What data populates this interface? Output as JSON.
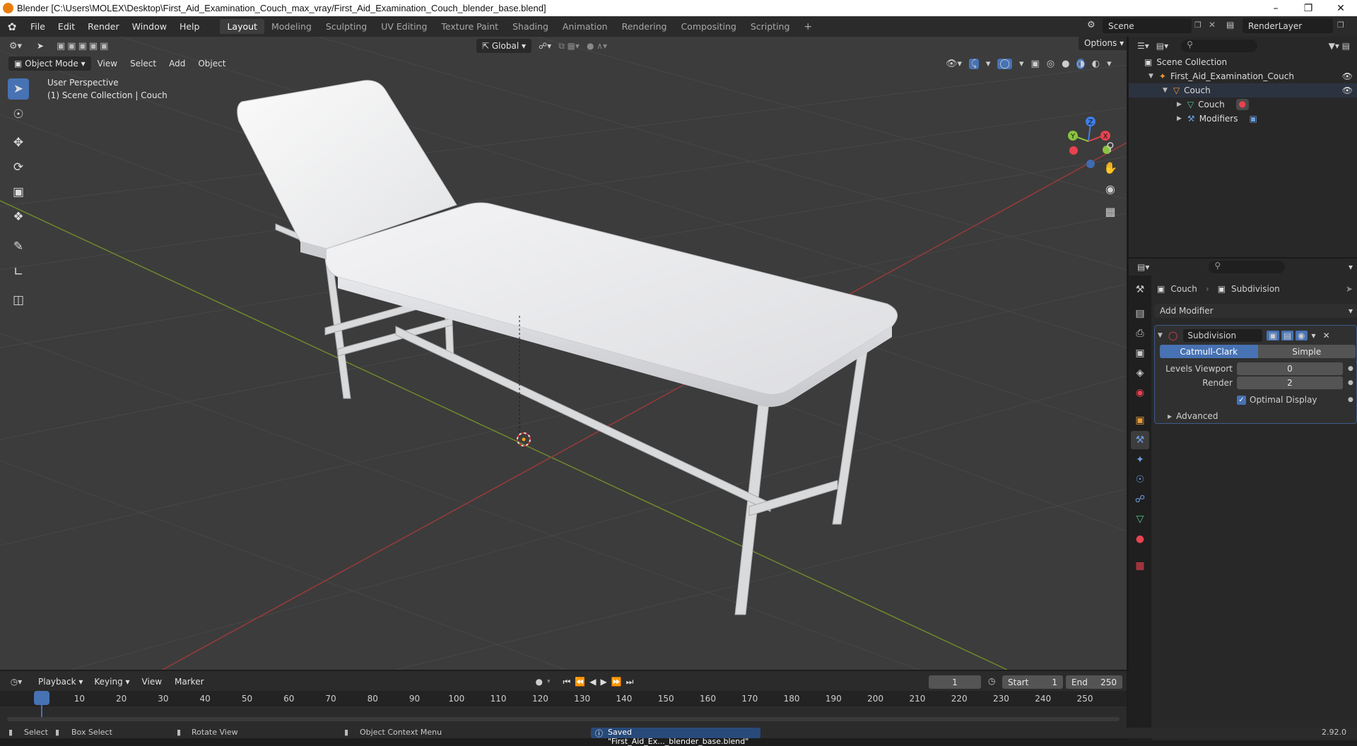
{
  "window": {
    "title": "Blender [C:\\Users\\MOLEX\\Desktop\\First_Aid_Examination_Couch_max_vray/First_Aid_Examination_Couch_blender_base.blend]"
  },
  "menu": [
    "File",
    "Edit",
    "Render",
    "Window",
    "Help"
  ],
  "workspaces": [
    "Layout",
    "Modeling",
    "Sculpting",
    "UV Editing",
    "Texture Paint",
    "Shading",
    "Animation",
    "Rendering",
    "Compositing",
    "Scripting"
  ],
  "active_workspace": "Layout",
  "scene": {
    "name": "Scene",
    "render_layer": "RenderLayer"
  },
  "viewport": {
    "mode": "Object Mode",
    "header_menus": [
      "View",
      "Select",
      "Add",
      "Object"
    ],
    "transform_orientation": "Global",
    "options_label": "Options",
    "overlay_text_1": "User Perspective",
    "overlay_text_2": "(1) Scene Collection | Couch",
    "gizmo": {
      "x": "X",
      "y": "Y",
      "z": "Z"
    }
  },
  "outliner": {
    "root": "Scene Collection",
    "items": [
      {
        "label": "First_Aid_Examination_Couch",
        "level": 1
      },
      {
        "label": "Couch",
        "level": 2
      },
      {
        "label": "Couch",
        "level": 3
      },
      {
        "label": "Modifiers",
        "level": 3
      }
    ]
  },
  "properties": {
    "breadcrumb_object": "Couch",
    "breadcrumb_modifier": "Subdivision",
    "add_modifier": "Add Modifier",
    "modifier": {
      "name": "Subdivision",
      "tab_catmull": "Catmull-Clark",
      "tab_simple": "Simple",
      "levels_viewport_label": "Levels Viewport",
      "levels_viewport_value": "0",
      "render_label": "Render",
      "render_value": "2",
      "optimal_display_label": "Optimal Display",
      "optimal_display_checked": true,
      "advanced_label": "Advanced"
    }
  },
  "timeline": {
    "menus": [
      "Playback",
      "Keying",
      "View",
      "Marker"
    ],
    "current_frame": "1",
    "start_label": "Start",
    "start_value": "1",
    "end_label": "End",
    "end_value": "250",
    "ticks": [
      "1",
      "10",
      "20",
      "30",
      "40",
      "50",
      "60",
      "70",
      "80",
      "90",
      "100",
      "110",
      "120",
      "130",
      "140",
      "150",
      "160",
      "170",
      "180",
      "190",
      "200",
      "210",
      "220",
      "230",
      "240",
      "250"
    ]
  },
  "status": {
    "select": "Select",
    "box_select": "Box Select",
    "rotate_view": "Rotate View",
    "context_menu": "Object Context Menu",
    "saved_message": "Saved \"First_Aid_Ex..._blender_base.blend\"",
    "version": "2.92.0"
  },
  "colors": {
    "accent": "#4772b3",
    "x_axis": "#e8424f",
    "y_axis": "#8bc43f",
    "z_axis": "#3f7de8",
    "viewport_bg": "#3c3c3c"
  }
}
